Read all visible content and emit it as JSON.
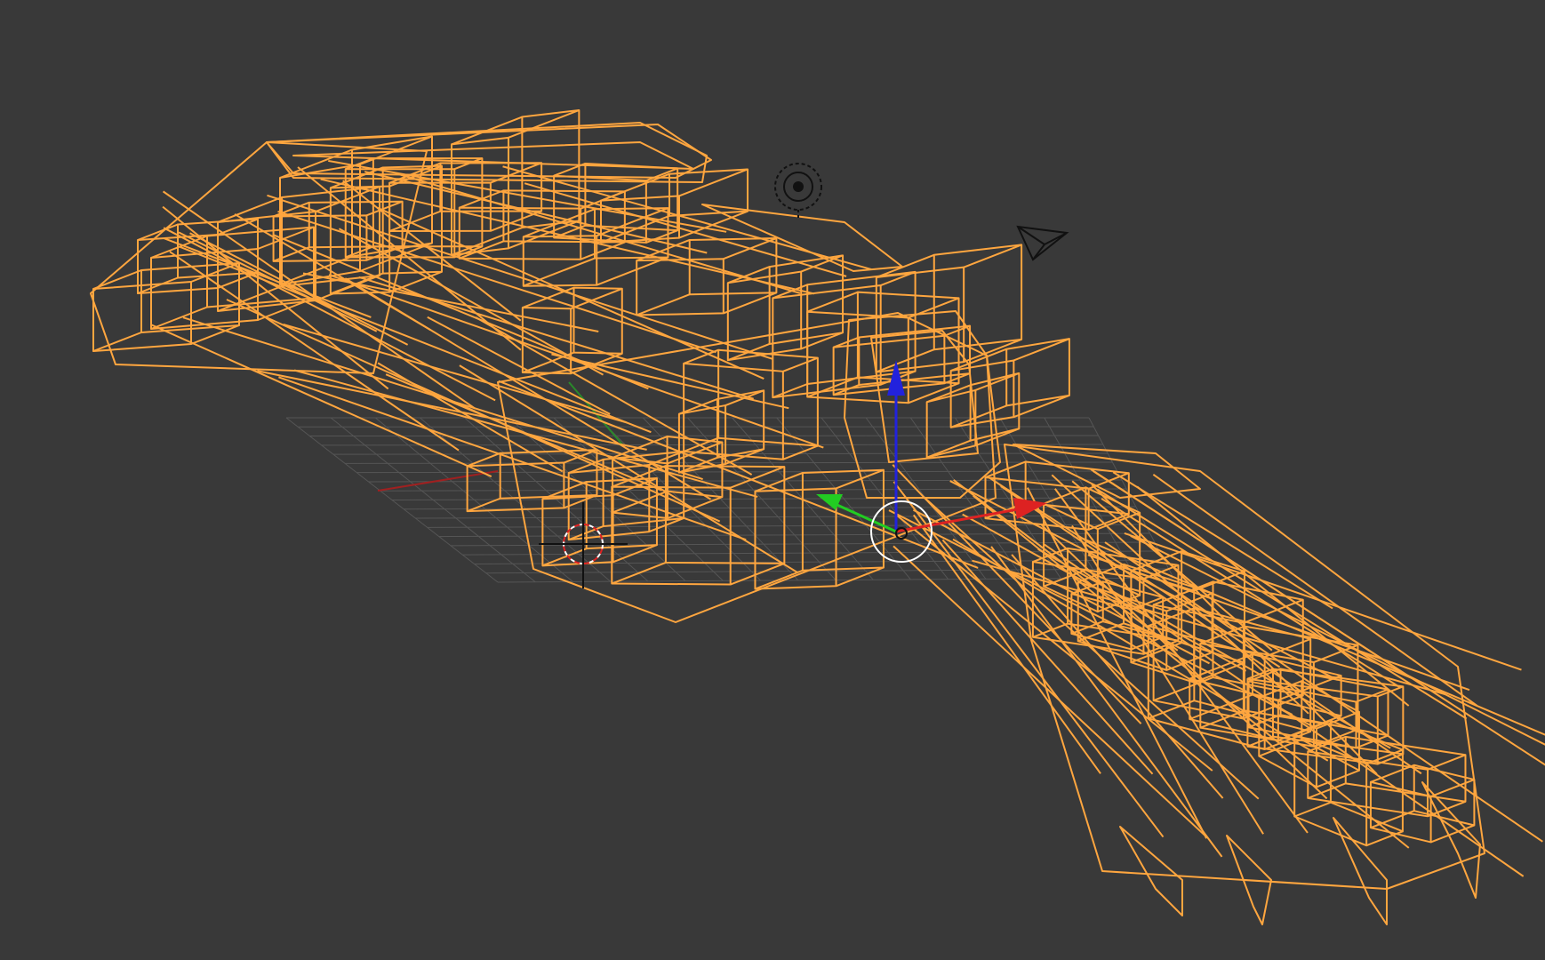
{
  "viewport": {
    "background": "#393939",
    "object_wire_color": "#ffa63f",
    "grid_color": "#555555",
    "x_axis_color": "#dd2222",
    "y_axis_color": "#22cc22",
    "z_axis_color": "#2222dd"
  },
  "scene": {
    "object": "wireframe-mesh",
    "icons": {
      "lamp": "lamp-icon",
      "camera": "camera-icon",
      "cursor": "3d-cursor-icon",
      "manipulator": "transform-manipulator-icon"
    }
  }
}
